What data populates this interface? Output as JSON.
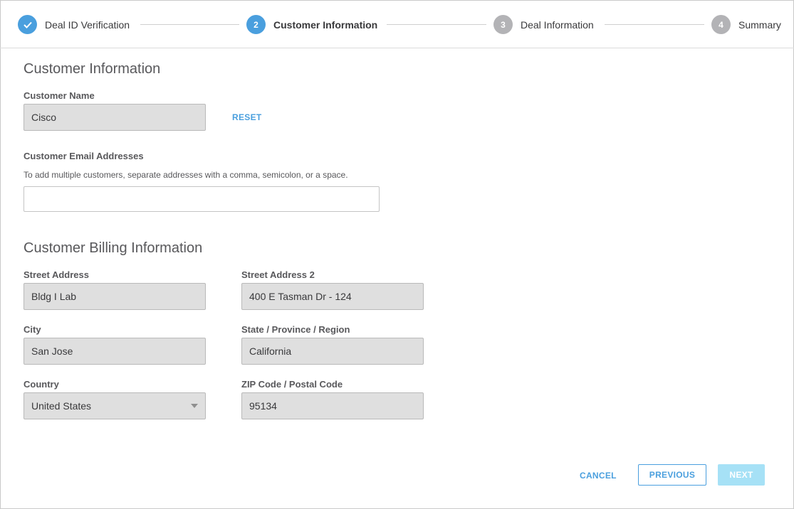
{
  "stepper": {
    "steps": [
      {
        "number": "",
        "label": "Deal ID Verification",
        "state": "done"
      },
      {
        "number": "2",
        "label": "Customer Information",
        "state": "active"
      },
      {
        "number": "3",
        "label": "Deal Information",
        "state": "todo"
      },
      {
        "number": "4",
        "label": "Summary",
        "state": "todo"
      }
    ]
  },
  "customer": {
    "title": "Customer Information",
    "name_label": "Customer Name",
    "name_value": "Cisco",
    "reset_label": "RESET",
    "email_label": "Customer Email Addresses",
    "email_hint": "To add multiple customers, separate addresses with a comma, semicolon, or a space.",
    "email_value": ""
  },
  "billing": {
    "title": "Customer Billing Information",
    "street_label": "Street Address",
    "street_value": "Bldg I Lab",
    "street2_label": "Street Address 2",
    "street2_value": "400 E Tasman Dr - 124",
    "city_label": "City",
    "city_value": "San Jose",
    "state_label": "State / Province / Region",
    "state_value": "California",
    "country_label": "Country",
    "country_value": "United States",
    "zip_label": "ZIP Code / Postal Code",
    "zip_value": "95134"
  },
  "actions": {
    "cancel": "CANCEL",
    "previous": "PREVIOUS",
    "next": "NEXT"
  },
  "colors": {
    "accent": "#4a9fde",
    "disabled": "#a6e1f6",
    "step_todo": "#b3b3b6"
  }
}
